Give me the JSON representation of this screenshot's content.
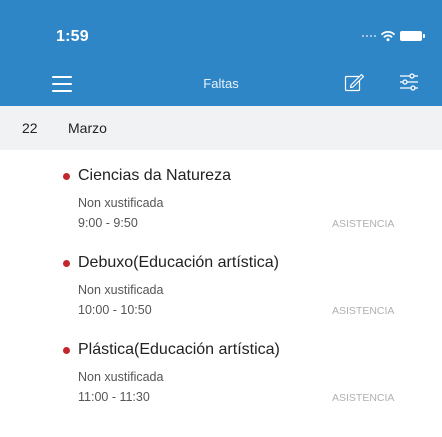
{
  "status_bar": {
    "time": "1:59"
  },
  "nav": {
    "title": "Faltas",
    "menu_icon": "hamburger-menu-icon",
    "edit_icon": "edit-pencil-icon",
    "filter_icon": "filter-sliders-icon"
  },
  "date": {
    "day": "22",
    "month": "Marzo"
  },
  "absences": [
    {
      "subject": "Ciencias da Natureza",
      "status": "Non xustificada",
      "time": "9:00 - 9:50",
      "kind": "ASISTENCIA"
    },
    {
      "subject": "Debuxo(Educación artística)",
      "status": "Non xustificada",
      "time": "10:00 - 10:50",
      "kind": "ASISTENCIA"
    },
    {
      "subject": "Plástica(Educación artística)",
      "status": "Non xustificada",
      "time": "11:00 - 11:30",
      "kind": "ASISTENCIA"
    }
  ],
  "colors": {
    "appbar": "#2f86c6",
    "date_header_bg": "#f1f2f4",
    "unjustified_dot": "#c1272d"
  }
}
